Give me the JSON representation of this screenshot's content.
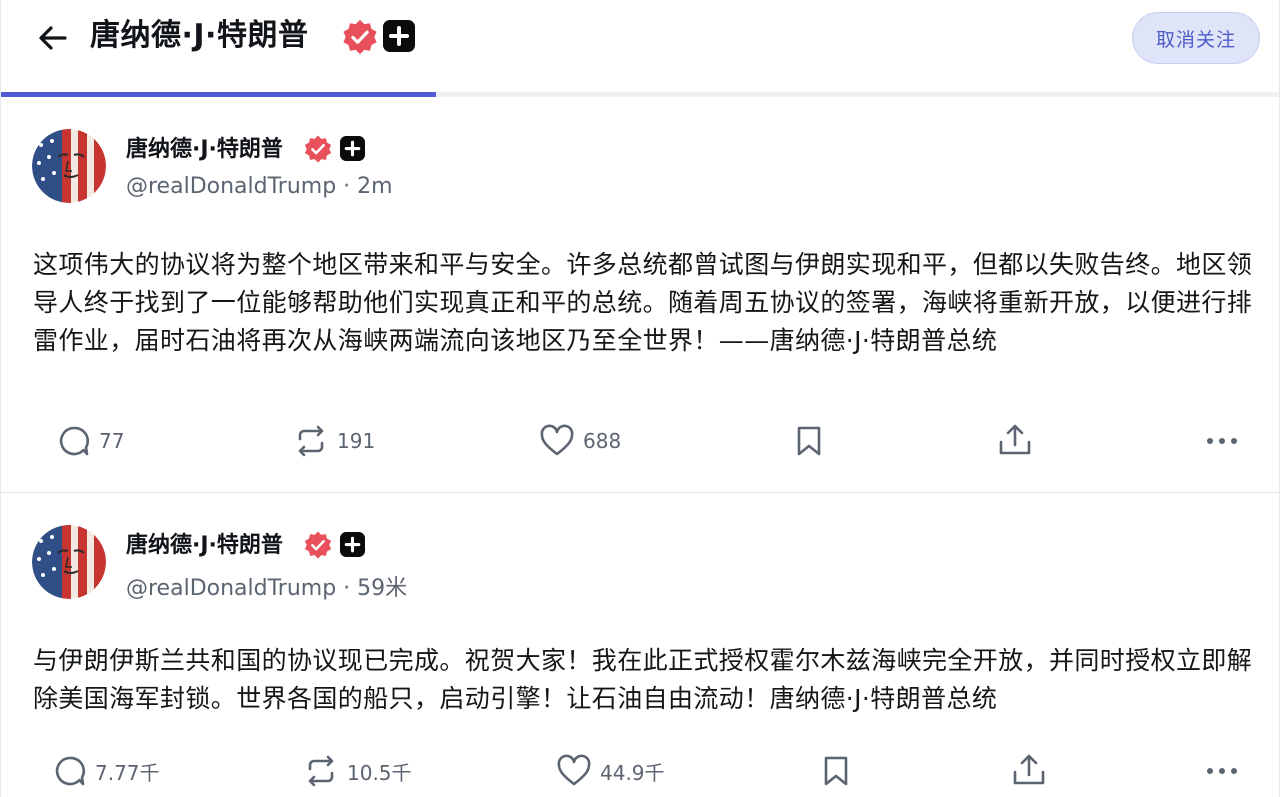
{
  "header": {
    "title": "唐纳德·J·特朗普",
    "unfollow_label": "取消关注",
    "progress": 0.34
  },
  "posts": [
    {
      "author_name": "唐纳德·J·特朗普",
      "meta": "@realDonaldTrump · 2m",
      "text": "这项伟大的协议将为整个地区带来和平与安全。许多总统都曾试图与伊朗实现和平，但都以失败告终。地区领导人终于找到了一位能够帮助他们实现真正和平的总统。随着周五协议的签署，海峡将重新开放，以便进行排雷作业，届时石油将再次从海峡两端流向该地区乃至全世界！——唐纳德·J·特朗普总统",
      "replies": "77",
      "reposts": "191",
      "likes": "688"
    },
    {
      "author_name": "唐纳德·J·特朗普",
      "meta": "@realDonaldTrump · 59米",
      "text": "与伊朗伊斯兰共和国的协议现已完成。祝贺大家！我在此正式授权霍尔木兹海峡完全开放，并同时授权立即解除美国海军封锁。世界各国的船只，启动引擎！让石油自由流动！唐纳德·J·特朗普总统",
      "replies": "7.77千",
      "reposts": "10.5千",
      "likes": "44.9千"
    }
  ],
  "icons": {
    "back": "arrow-left-icon",
    "verified": "verified-badge-icon",
    "plus": "plus-badge-icon",
    "reply": "comment-icon",
    "repost": "repost-icon",
    "like": "heart-icon",
    "bookmark": "bookmark-icon",
    "share": "share-icon",
    "more": "more-dots-icon"
  },
  "colors": {
    "accent": "#4f5bd5",
    "verified": "#e8505b",
    "unfollow_bg": "#dfe4f8",
    "muted": "#5b6470"
  }
}
